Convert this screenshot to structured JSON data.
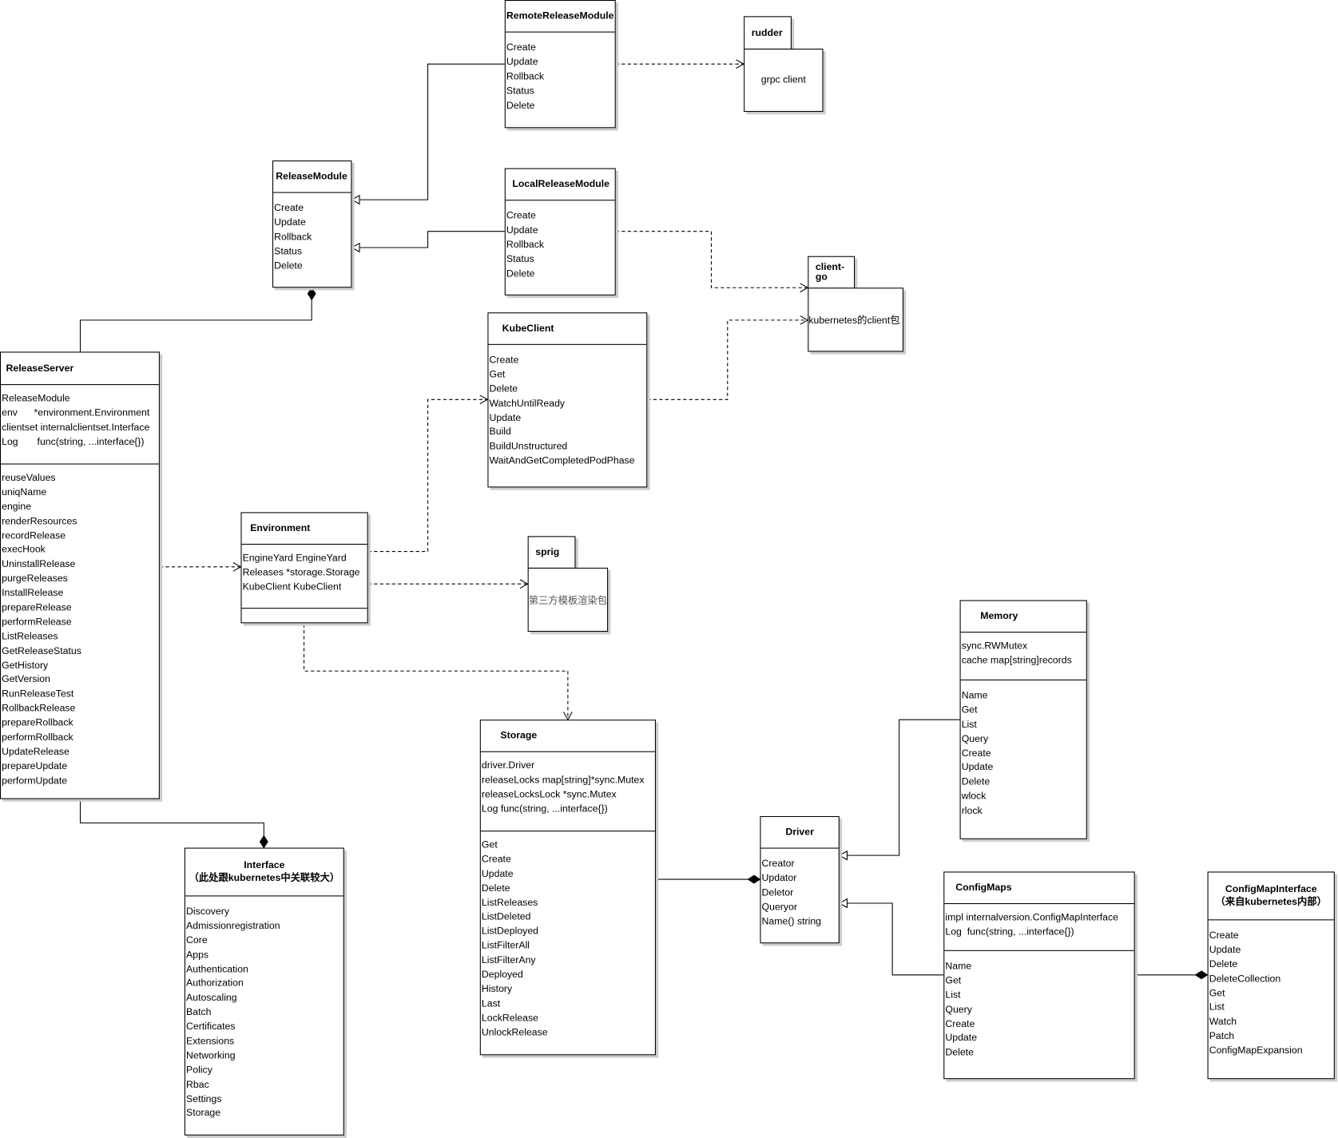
{
  "classes": [
    {
      "id": "remote",
      "name": "RemoteReleaseModule",
      "subtitle": "",
      "attributes": null,
      "methods": [
        "Create",
        "Update",
        "Rollback",
        "Status",
        "Delete"
      ]
    },
    {
      "id": "releasemodule",
      "name": "ReleaseModule",
      "subtitle": "",
      "attributes": null,
      "methods": [
        "Create",
        "Update",
        "Rollback",
        "Status",
        "Delete"
      ]
    },
    {
      "id": "local",
      "name": "LocalReleaseModule",
      "subtitle": "",
      "attributes": null,
      "methods": [
        "Create",
        "Update",
        "Rollback",
        "Status",
        "Delete"
      ]
    },
    {
      "id": "kubeclient",
      "name": "KubeClient",
      "subtitle": "",
      "attributes": null,
      "methods": [
        "Create",
        "Get",
        "Delete",
        "WatchUntilReady",
        "Update",
        "Build",
        "BuildUnstructured",
        "WaitAndGetCompletedPodPhase"
      ]
    },
    {
      "id": "releaseserver",
      "name": "ReleaseServer",
      "subtitle": "",
      "attributes": [
        "ReleaseModule",
        "env      *environment.Environment",
        "clientset internalclientset.Interface",
        "Log       func(string, ...interface{})"
      ],
      "methods": [
        "reuseValues",
        "uniqName",
        "engine",
        "renderResources",
        "recordRelease",
        "execHook",
        "UninstallRelease",
        "purgeReleases",
        "InstallRelease",
        "prepareRelease",
        "performRelease",
        "ListReleases",
        "GetReleaseStatus",
        "GetHistory",
        "GetVersion",
        "RunReleaseTest",
        "RollbackRelease",
        "prepareRollback",
        "performRollback",
        "UpdateRelease",
        "prepareUpdate",
        "performUpdate"
      ]
    },
    {
      "id": "environment",
      "name": "Environment",
      "subtitle": "",
      "attributes": [
        "EngineYard EngineYard",
        "Releases *storage.Storage",
        "KubeClient KubeClient"
      ],
      "methods": []
    },
    {
      "id": "memory",
      "name": "Memory",
      "subtitle": "",
      "attributes": [
        "sync.RWMutex",
        "cache map[string]records"
      ],
      "methods": [
        "Name",
        "Get",
        "List",
        "Query",
        "Create",
        "Update",
        "Delete",
        "wlock",
        "rlock"
      ]
    },
    {
      "id": "storage",
      "name": "Storage",
      "subtitle": "",
      "attributes": [
        "driver.Driver",
        "releaseLocks map[string]*sync.Mutex",
        "releaseLocksLock *sync.Mutex",
        "Log func(string, ...interface{})"
      ],
      "methods": [
        "Get",
        "Create",
        "Update",
        "Delete",
        "ListReleases",
        "ListDeleted",
        "ListDeployed",
        "ListFilterAll",
        "ListFilterAny",
        "Deployed",
        "History",
        "Last",
        "LockRelease",
        "UnlockRelease"
      ]
    },
    {
      "id": "driver",
      "name": "Driver",
      "subtitle": "",
      "attributes": null,
      "methods": [
        "Creator",
        "Updator",
        "Deletor",
        "Queryor",
        "Name() string"
      ]
    },
    {
      "id": "interface",
      "name": "Interface",
      "subtitle": "（此处跟kubernetes中关联较大）",
      "attributes": null,
      "methods": [
        "Discovery",
        "Admissionregistration",
        "Core",
        "Apps",
        "Authentication",
        "Authorization",
        "Autoscaling",
        "Batch",
        "Certificates",
        "Extensions",
        "Networking",
        "Policy",
        "Rbac",
        "Settings",
        "Storage"
      ]
    },
    {
      "id": "configmaps",
      "name": "ConfigMaps",
      "subtitle": "",
      "attributes": [
        "impl internalversion.ConfigMapInterface",
        "Log  func(string, ...interface{})"
      ],
      "methods": [
        "Name",
        "Get",
        "List",
        "Query",
        "Create",
        "Update",
        "Delete"
      ]
    },
    {
      "id": "configmapinterface",
      "name": "ConfigMapInterface",
      "subtitle": "（来自kubernetes内部）",
      "attributes": null,
      "methods": [
        "Create",
        "Update",
        "Delete",
        "DeleteCollection",
        "Get",
        "List",
        "Watch",
        "Patch",
        "ConfigMapExpansion"
      ]
    }
  ],
  "packages": [
    {
      "id": "rudder",
      "name": "rudder",
      "description": "grpc client"
    },
    {
      "id": "clientgo",
      "name": "client-go",
      "description": "kubernetes的client包"
    },
    {
      "id": "sprig",
      "name": "sprig",
      "description": "第三方模板渲染包"
    }
  ],
  "relations": [
    {
      "from": "RemoteReleaseModule",
      "to": "ReleaseModule",
      "type": "generalization"
    },
    {
      "from": "LocalReleaseModule",
      "to": "ReleaseModule",
      "type": "generalization"
    },
    {
      "from": "ReleaseServer",
      "to": "ReleaseModule",
      "type": "composition"
    },
    {
      "from": "RemoteReleaseModule",
      "to": "rudder",
      "type": "dependency"
    },
    {
      "from": "LocalReleaseModule",
      "to": "client-go",
      "type": "dependency"
    },
    {
      "from": "KubeClient",
      "to": "client-go",
      "type": "dependency"
    },
    {
      "from": "Environment",
      "to": "KubeClient",
      "type": "dependency"
    },
    {
      "from": "Environment",
      "to": "sprig",
      "type": "dependency"
    },
    {
      "from": "ReleaseServer",
      "to": "Environment",
      "type": "dependency"
    },
    {
      "from": "Environment",
      "to": "Storage",
      "type": "dependency"
    },
    {
      "from": "ReleaseServer",
      "to": "Interface",
      "type": "composition"
    },
    {
      "from": "Storage",
      "to": "Driver",
      "type": "composition"
    },
    {
      "from": "Memory",
      "to": "Driver",
      "type": "generalization"
    },
    {
      "from": "ConfigMaps",
      "to": "Driver",
      "type": "generalization"
    },
    {
      "from": "ConfigMaps",
      "to": "ConfigMapInterface",
      "type": "composition"
    }
  ]
}
